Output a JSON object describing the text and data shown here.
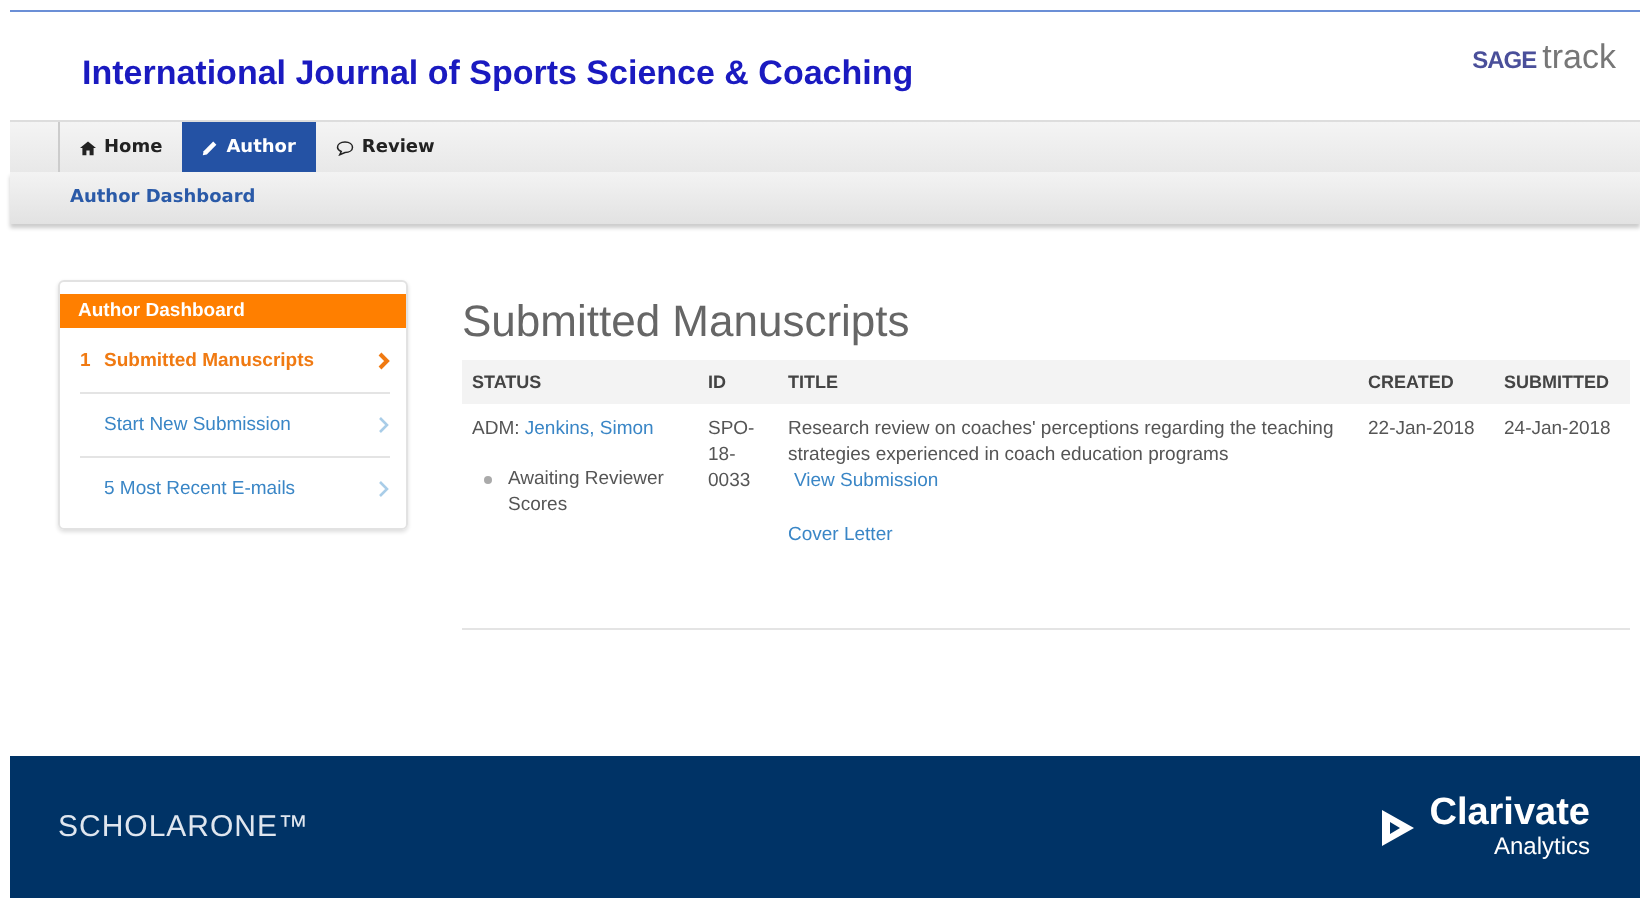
{
  "header": {
    "journal_title": "International Journal of Sports Science & Coaching",
    "logo": {
      "brand": "SAGE",
      "product": "track"
    }
  },
  "tabs": [
    {
      "label": "Home",
      "selected": false
    },
    {
      "label": "Author",
      "selected": true
    },
    {
      "label": "Review",
      "selected": false
    }
  ],
  "breadcrumb": "Author Dashboard",
  "sidebar": {
    "title": "Author Dashboard",
    "items": [
      {
        "count": "1",
        "label": "Submitted Manuscripts",
        "selected": true
      },
      {
        "label": "Start New Submission",
        "selected": false
      },
      {
        "label": "5 Most Recent E-mails",
        "selected": false
      }
    ]
  },
  "page_title": "Submitted Manuscripts",
  "table": {
    "columns": [
      "STATUS",
      "ID",
      "TITLE",
      "CREATED",
      "SUBMITTED"
    ],
    "rows": [
      {
        "status_prefix": "ADM:",
        "status_person": "Jenkins, Simon",
        "status_note": "Awaiting Reviewer Scores",
        "id": "SPO-18-0033",
        "title": "Research review on coaches' perceptions regarding the teaching strategies experienced in coach education programs",
        "links": [
          "View Submission",
          "Cover Letter"
        ],
        "created": "22-Jan-2018",
        "submitted": "24-Jan-2018"
      }
    ]
  },
  "footer": {
    "brand": "SCHOLARONE™",
    "company": "Clarivate",
    "company_sub": "Analytics"
  }
}
